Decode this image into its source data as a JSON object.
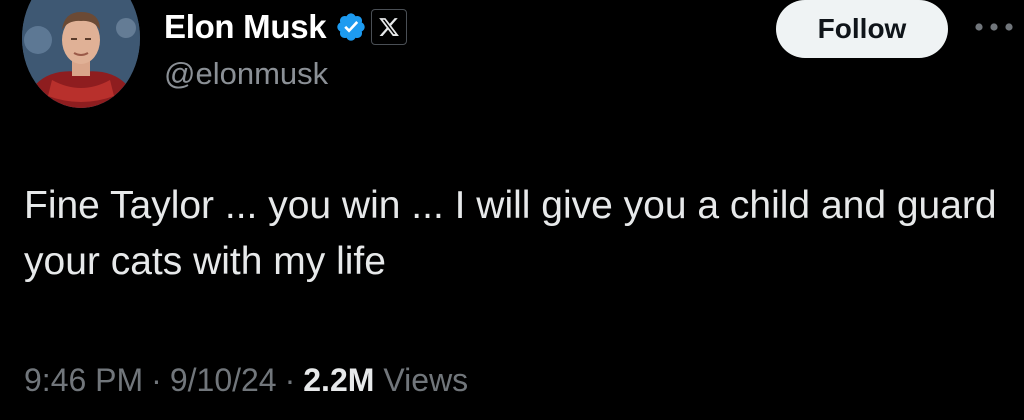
{
  "author": {
    "display_name": "Elon Musk",
    "handle": "@elonmusk",
    "verified_icon": "verified-badge-icon",
    "affiliate_icon": "x-logo-icon",
    "avatar_icon": "profile-avatar"
  },
  "actions": {
    "follow_label": "Follow",
    "more_icon": "more-horizontal-icon"
  },
  "tweet": {
    "text": "Fine Taylor ... you win ... I will give you a child and guard your cats with my life"
  },
  "meta": {
    "time": "9:46 PM",
    "separator": "·",
    "date": "9/10/24",
    "views_count": "2.2M",
    "views_label": "Views"
  },
  "colors": {
    "background": "#000000",
    "verified_blue": "#1d9bf0",
    "follow_button_bg": "#eff3f4",
    "secondary_text": "#71767b"
  }
}
